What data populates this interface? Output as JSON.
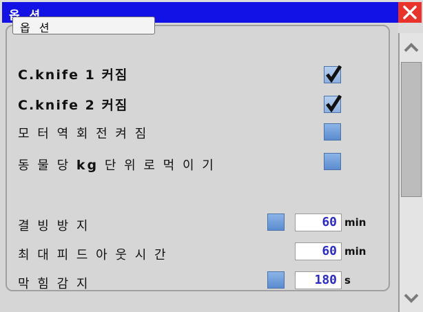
{
  "window": {
    "title": "옵 션"
  },
  "group": {
    "title": "옵 션"
  },
  "options": {
    "knife1": {
      "label": "C.knife 1 커짐",
      "checked": true
    },
    "knife2": {
      "label": "C.knife 2 커짐",
      "checked": true
    },
    "reverse": {
      "label": "모 터  역 회 전  켜 짐",
      "checked": false
    },
    "perkg": {
      "label_pre": "동 물  당 ",
      "label_kg": "kg",
      "label_post": " 단 위 로  먹 이 기",
      "checked": false
    }
  },
  "settings": {
    "freeze": {
      "label": "결 빙  방 지",
      "value": "60",
      "unit": "min",
      "checked": false
    },
    "maxfeed": {
      "label": "최 대  피 드 아 웃  시 간",
      "value": "60",
      "unit": "min"
    },
    "block": {
      "label": "막 힘  감 지",
      "value": "180",
      "unit": "s",
      "checked": false
    }
  },
  "colors": {
    "titlebar": "#1212e6",
    "close": "#e8322a",
    "value_text": "#2a2ad0"
  },
  "icons": {
    "close": "close-icon",
    "check": "checkmark-icon",
    "up": "chevron-up-icon",
    "down": "chevron-down-icon"
  }
}
